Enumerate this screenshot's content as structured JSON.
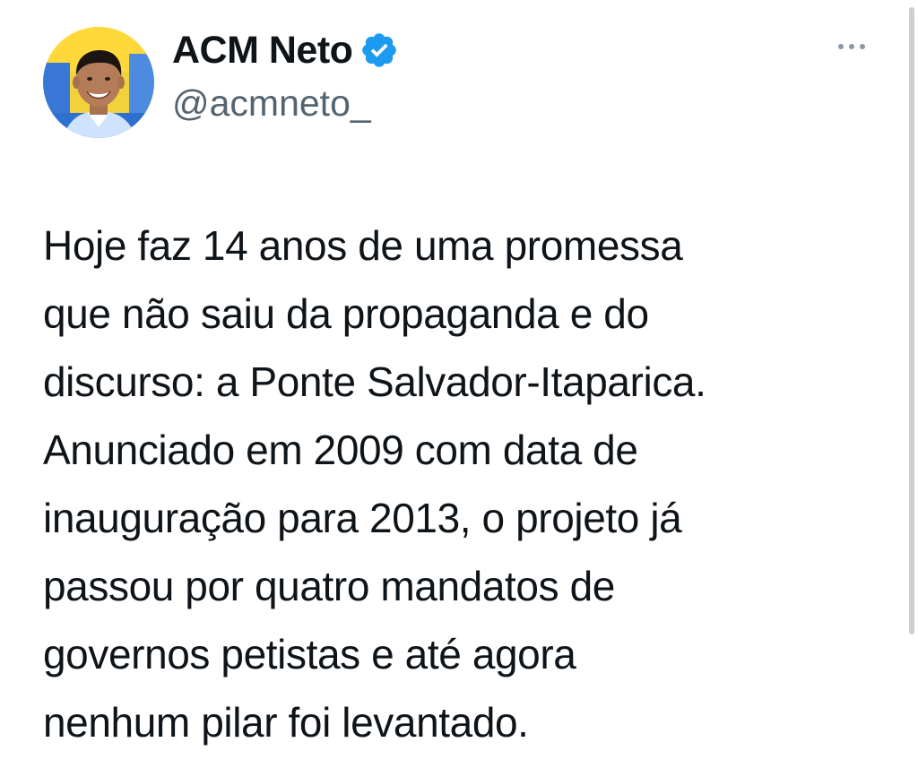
{
  "author": {
    "display_name": "ACM Neto",
    "handle": "@acmneto_",
    "verified": true,
    "avatar_icon": "profile-photo"
  },
  "menu": {
    "icon": "more-options-icon",
    "glyph": "···"
  },
  "tweet": {
    "text": "Hoje faz 14 anos de uma promessa\nque não saiu da propaganda e do\ndiscurso: a Ponte Salvador-Itaparica.\nAnunciado em 2009 com data de\ninauguração para 2013, o projeto já\npassou por quatro mandatos de\ngovernos petistas e até agora\nnenhum pilar foi levantado."
  },
  "colors": {
    "text": "#0f1419",
    "secondary": "#536471",
    "verified_badge": "#1d9bf0",
    "background": "#ffffff"
  }
}
